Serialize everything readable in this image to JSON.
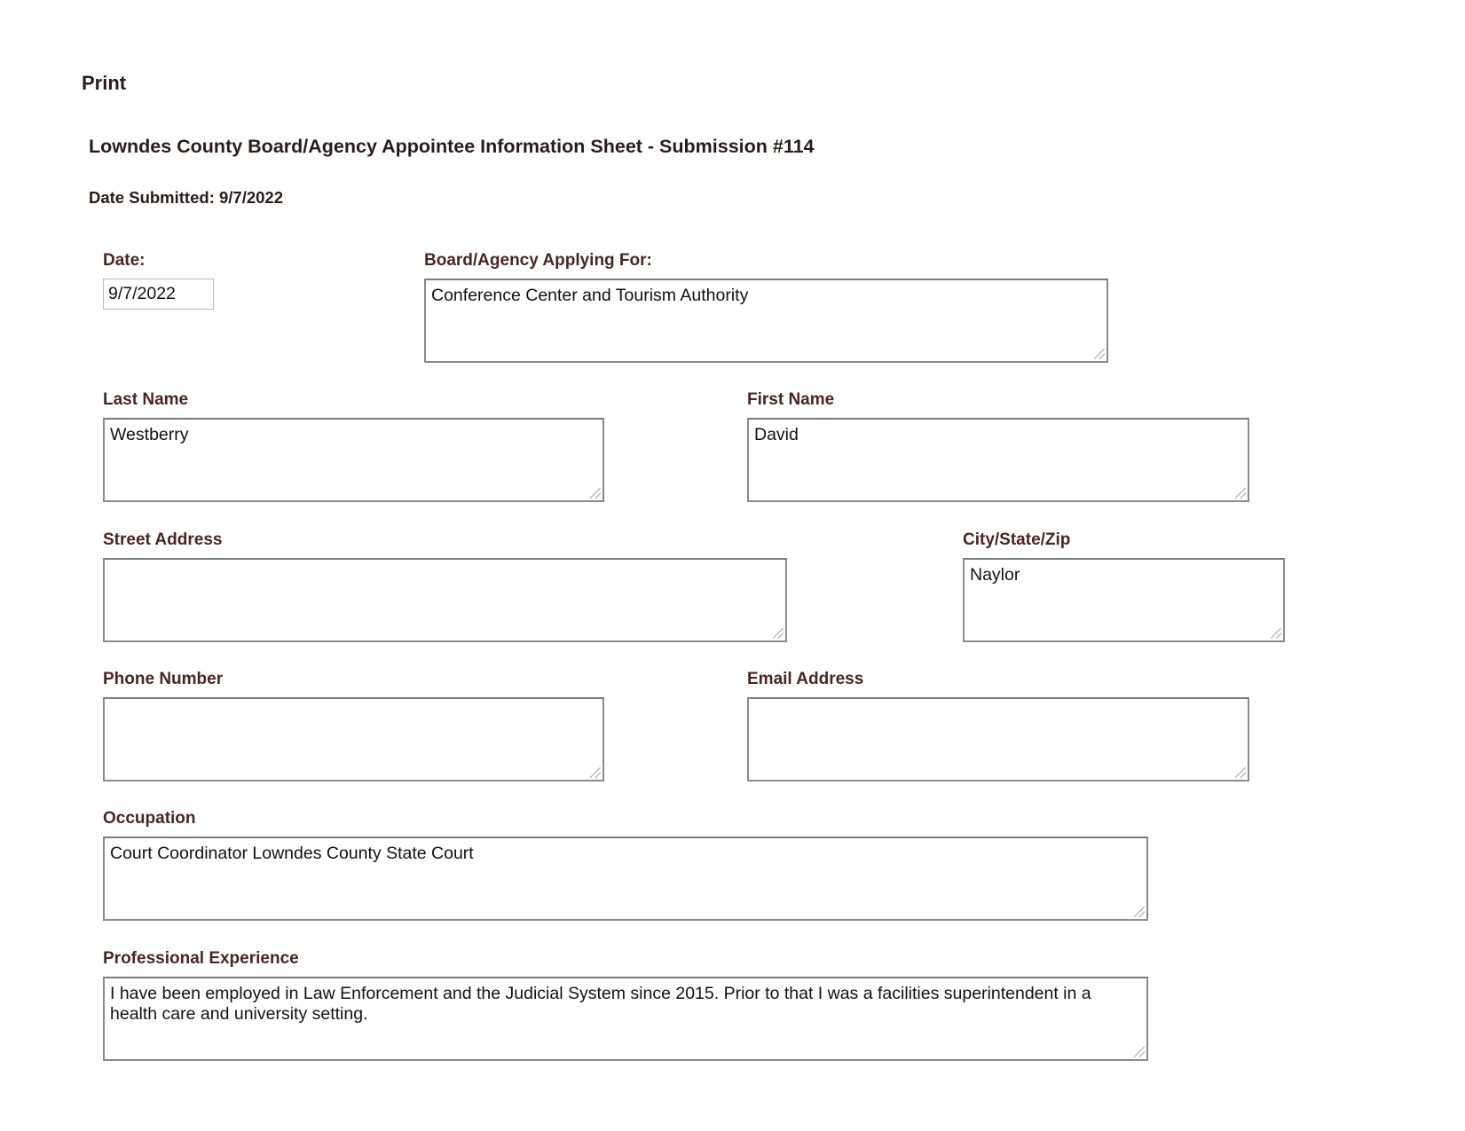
{
  "toolbar": {
    "print_label": "Print"
  },
  "header": {
    "title": "Lowndes County Board/Agency Appointee Information Sheet - Submission #114",
    "date_submitted": "Date Submitted: 9/7/2022"
  },
  "form": {
    "date": {
      "label": "Date:",
      "value": "9/7/2022"
    },
    "board": {
      "label": "Board/Agency Applying For:",
      "value": "Conference Center and Tourism Authority"
    },
    "last_name": {
      "label": "Last Name",
      "value": "Westberry"
    },
    "first_name": {
      "label": "First Name",
      "value": "David"
    },
    "street_address": {
      "label": "Street Address",
      "value": ""
    },
    "city_state_zip": {
      "label": "City/State/Zip",
      "value": "Naylor"
    },
    "phone_number": {
      "label": "Phone Number",
      "value": ""
    },
    "email_address": {
      "label": "Email Address",
      "value": ""
    },
    "occupation": {
      "label": "Occupation",
      "value": "Court Coordinator Lowndes County State Court"
    },
    "professional_experience": {
      "label": "Professional Experience",
      "value": "I have been employed in Law Enforcement and the Judicial System since 2015. Prior to that I was a facilities superintendent in a health care and university setting."
    }
  },
  "colors": {
    "label_color": "#4a2620",
    "heading_color": "#2b1b1b",
    "box_border": "#8a8a8a",
    "date_input_border": "#a9bfd0"
  }
}
